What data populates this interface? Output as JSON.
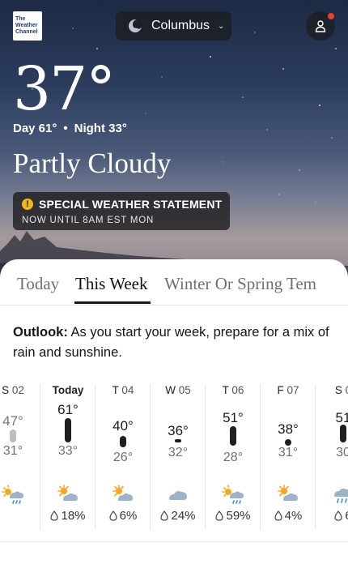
{
  "header": {
    "logo_lines": [
      "The",
      "Weather",
      "Channel"
    ],
    "location": "Columbus",
    "location_chevron": "⌄"
  },
  "current": {
    "temperature": "37°",
    "day_label": "Day 61°",
    "night_label": "Night 33°",
    "separator": "•",
    "condition": "Partly Cloudy"
  },
  "alert": {
    "icon": "!",
    "title": "SPECIAL WEATHER STATEMENT",
    "subtitle": "NOW UNTIL 8AM EST MON"
  },
  "tabs": [
    {
      "label": "Today",
      "active": false
    },
    {
      "label": "This Week",
      "active": true
    },
    {
      "label": "Winter Or Spring Tem",
      "active": false
    }
  ],
  "outlook": {
    "label": "Outlook:",
    "text": " As you start your week, prepare for a mix of rain and sunshine."
  },
  "forecast": [
    {
      "dow": "S",
      "date": "02",
      "hi": "47°",
      "lo": "31°",
      "bar": "gray",
      "icon": "sun-rain-icon",
      "precip": ""
    },
    {
      "dow": "Today",
      "date": "",
      "hi": "61°",
      "lo": "33°",
      "bar": "dark",
      "icon": "partly-cloudy-day-icon",
      "precip": "18%"
    },
    {
      "dow": "T",
      "date": "04",
      "hi": "40°",
      "lo": "26°",
      "bar": "dark",
      "icon": "partly-cloudy-day-icon",
      "precip": "6%"
    },
    {
      "dow": "W",
      "date": "05",
      "hi": "36°",
      "lo": "32°",
      "bar": "dark",
      "icon": "cloudy-icon",
      "precip": "24%"
    },
    {
      "dow": "T",
      "date": "06",
      "hi": "51°",
      "lo": "28°",
      "bar": "dark",
      "icon": "sun-rain-icon",
      "precip": "59%"
    },
    {
      "dow": "F",
      "date": "07",
      "hi": "38°",
      "lo": "31°",
      "bar": "dark",
      "icon": "partly-cloudy-day-icon",
      "precip": "4%"
    },
    {
      "dow": "S",
      "date": "0",
      "hi": "51",
      "lo": "30",
      "bar": "dark",
      "icon": "rain-icon",
      "precip": "6"
    }
  ],
  "colors": {
    "accent_alert": "#f2b61d",
    "notification_dot": "#e8412b",
    "sun": "#f6a623",
    "cloud": "#9fb3c8",
    "rain": "#3e8ed0"
  }
}
